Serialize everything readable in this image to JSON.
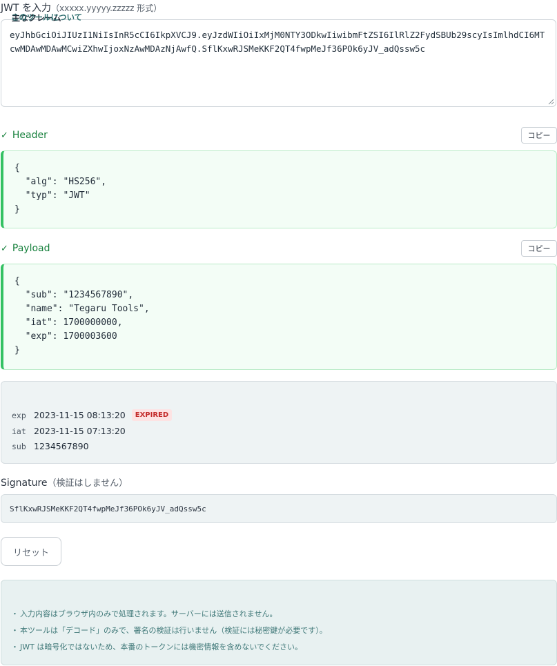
{
  "input": {
    "label": "JWT を入力",
    "format_hint": "（xxxxx.yyyyy.zzzzz 形式）",
    "value": "eyJhbGciOiJIUzI1NiIsInR5cCI6IkpXVCJ9.eyJzdWIiOiIxMjM0NTY3ODkwIiwibmFtZSI6IlRlZ2FydSBUb29scyIsImlhdCI6MTcwMDAwMDAwMCwiZXhwIjoxNzAwMDAzNjAwfQ.SflKxwRJSMeKKF2QT4fwpMeJf36POk6yJV_adQssw5c"
  },
  "header": {
    "check": "✓",
    "title": "Header",
    "copy_label": "コピー",
    "lines": [
      "{",
      "  \"alg\": \"HS256\",",
      "  \"typ\": \"JWT\"",
      "}"
    ]
  },
  "payload": {
    "check": "✓",
    "title": "Payload",
    "copy_label": "コピー",
    "lines": [
      "{",
      "  \"sub\": \"1234567890\",",
      "  \"name\": \"Tegaru Tools\",",
      "  \"iat\": 1700000000,",
      "  \"exp\": 1700003600",
      "}"
    ]
  },
  "claims": {
    "title": "主なクレーム",
    "rows": [
      {
        "key": "exp",
        "value": "2023-11-15 08:13:20",
        "badge": "EXPIRED"
      },
      {
        "key": "iat",
        "value": "2023-11-15 07:13:20"
      },
      {
        "key": "sub",
        "value": "1234567890"
      }
    ]
  },
  "signature": {
    "label": "Signature",
    "note": "（検証はしません）",
    "value": "SflKxwRJSMeKKF2QT4fwpMeJf36POk6yJV_adQssw5c"
  },
  "reset_label": "リセット",
  "about": {
    "title": "このツールについて",
    "bullet": "・",
    "items": [
      "入力内容はブラウザ内のみで処理されます。サーバーには送信されません。",
      "本ツールは「デコード」のみで、署名の検証は行いません（検証には秘密鍵が必要です）。",
      "JWT は暗号化ではないため、本番のトークンには機密情報を含めないでください。"
    ]
  },
  "colors": {
    "success": "#16803c",
    "success_border": "#34c163",
    "expired_text": "#c32a2a",
    "expired_bg": "#fde3e3"
  }
}
